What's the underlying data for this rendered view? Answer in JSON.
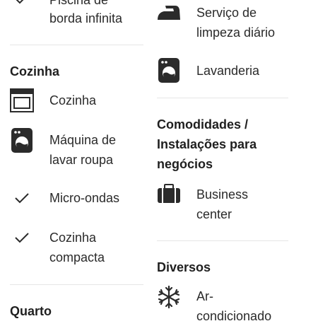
{
  "left_column": {
    "top_item_line1": "Piscina de",
    "top_item_line2": "borda infinita",
    "kitchen_section": {
      "title": "Cozinha",
      "items": [
        {
          "icon": "oven-icon",
          "line1": "Cozinha"
        },
        {
          "icon": "washing-machine-icon",
          "line1": "Máquina de",
          "line2": "lavar roupa"
        },
        {
          "icon": "check-icon",
          "line1": "Micro-ondas"
        },
        {
          "icon": "check-icon",
          "line1": "Cozinha",
          "line2": "compacta"
        }
      ]
    },
    "room_section": {
      "title": "Quarto"
    }
  },
  "right_column": {
    "top_item": {
      "icon": "iron-icon",
      "line1": "Serviço de",
      "line2": "limpeza diário"
    },
    "laundry_item": {
      "icon": "washing-machine-icon",
      "line1": "Lavanderia"
    },
    "business_section": {
      "title_line1": "Comodidades /",
      "title_line2": "Instalações para",
      "title_line3": "negócios",
      "items": [
        {
          "icon": "briefcase-icon",
          "line1": "Business",
          "line2": "center"
        }
      ]
    },
    "misc_section": {
      "title": "Diversos",
      "items": [
        {
          "icon": "snowflake-icon",
          "line1": "Ar-",
          "line2": "condicionado"
        }
      ]
    }
  },
  "colors": {
    "icon": "#2b2b2b",
    "divider": "#e6e6e6",
    "text": "#2a2a2a"
  }
}
